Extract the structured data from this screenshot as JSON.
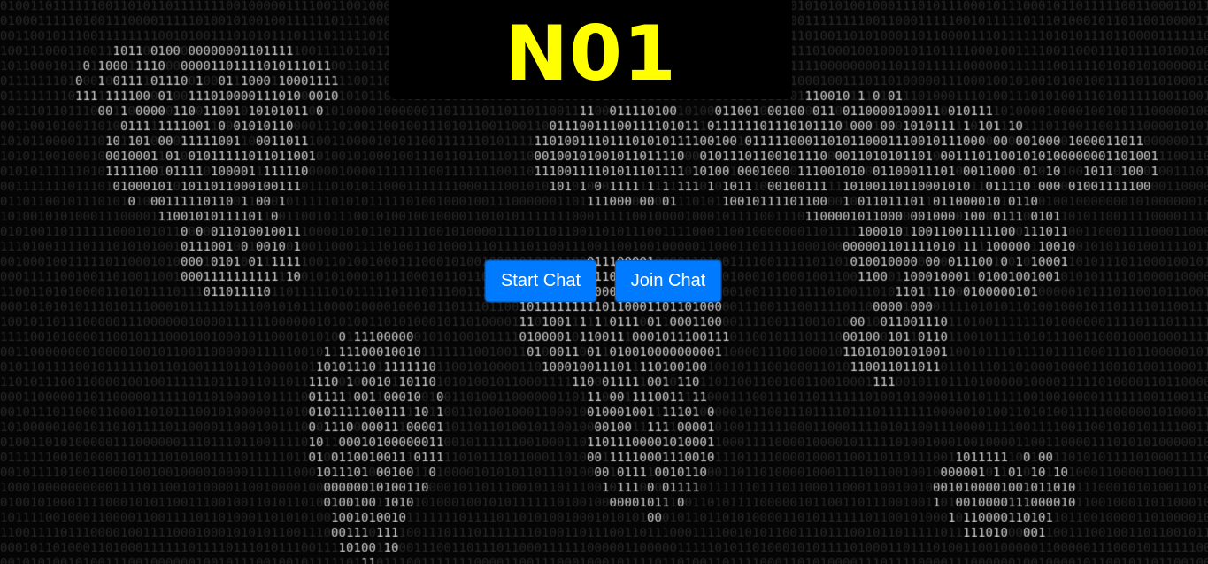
{
  "header": {
    "title": "N01"
  },
  "actions": {
    "start_chat_label": "Start Chat",
    "join_chat_label": "Join Chat"
  },
  "colors": {
    "background": "#050505",
    "title_box": "#000000",
    "title_text": "#ffff00",
    "button": "#007bff",
    "binary_dim": "#2a2a2a",
    "binary_bright": "#d0d0d0"
  }
}
